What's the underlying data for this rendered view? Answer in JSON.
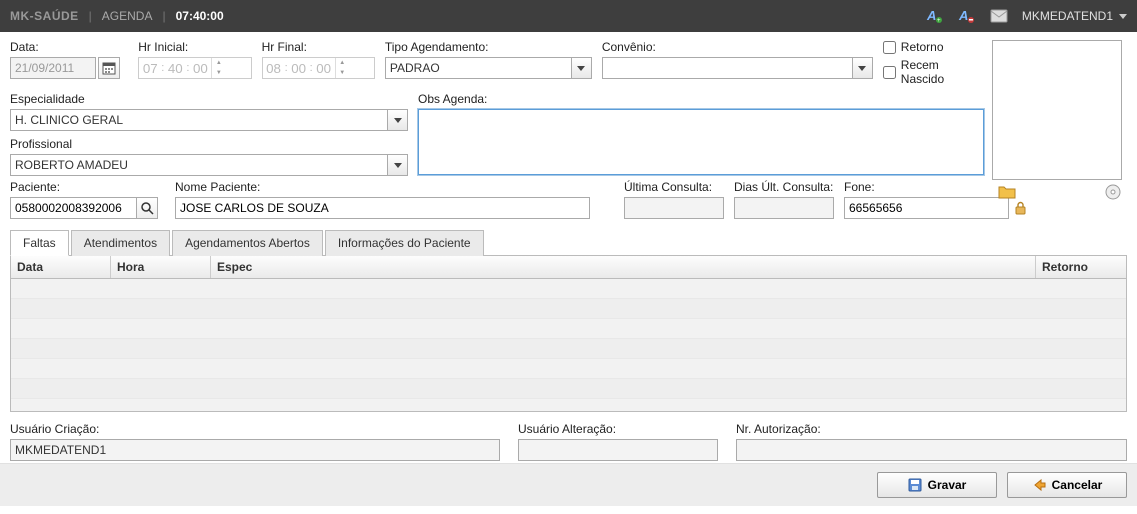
{
  "topbar": {
    "brand": "MK-SAÚDE",
    "section": "AGENDA",
    "time": "07:40:00",
    "user": "MKMEDATEND1"
  },
  "labels": {
    "data": "Data:",
    "hr_inicial": "Hr Inicial:",
    "hr_final": "Hr Final:",
    "tipo_agendamento": "Tipo Agendamento:",
    "convenio": "Convênio:",
    "retorno": "Retorno",
    "recem_nascido": "Recem Nascido",
    "especialidade": "Especialidade",
    "obs_agenda": "Obs Agenda:",
    "profissional": "Profissional",
    "paciente": "Paciente:",
    "nome_paciente": "Nome Paciente:",
    "ultima_consulta": "Última Consulta:",
    "dias_ult_consulta": "Dias Últ. Consulta:",
    "fone": "Fone:",
    "usuario_criacao": "Usuário Criação:",
    "usuario_alteracao": "Usuário Alteração:",
    "nr_autorizacao": "Nr. Autorização:"
  },
  "values": {
    "data": "21/09/2011",
    "hr_inicial": {
      "h": "07",
      "m": "40",
      "s": "00"
    },
    "hr_final": {
      "h": "08",
      "m": "00",
      "s": "00"
    },
    "tipo_agendamento": "PADRAO",
    "convenio": "",
    "especialidade": "H. CLINICO GERAL",
    "profissional": "ROBERTO AMADEU",
    "obs_agenda": "",
    "paciente": "0580002008392006",
    "nome_paciente": "JOSE CARLOS DE SOUZA",
    "ultima_consulta": "",
    "dias_ult_consulta": "",
    "fone": "66565656",
    "usuario_criacao": "MKMEDATEND1",
    "usuario_alteracao": "",
    "nr_autorizacao": ""
  },
  "tabs": [
    "Faltas",
    "Atendimentos",
    "Agendamentos Abertos",
    "Informações do Paciente"
  ],
  "active_tab": 0,
  "grid": {
    "columns": [
      "Data",
      "Hora",
      "Espec",
      "Retorno"
    ]
  },
  "buttons": {
    "gravar": "Gravar",
    "cancelar": "Cancelar"
  }
}
